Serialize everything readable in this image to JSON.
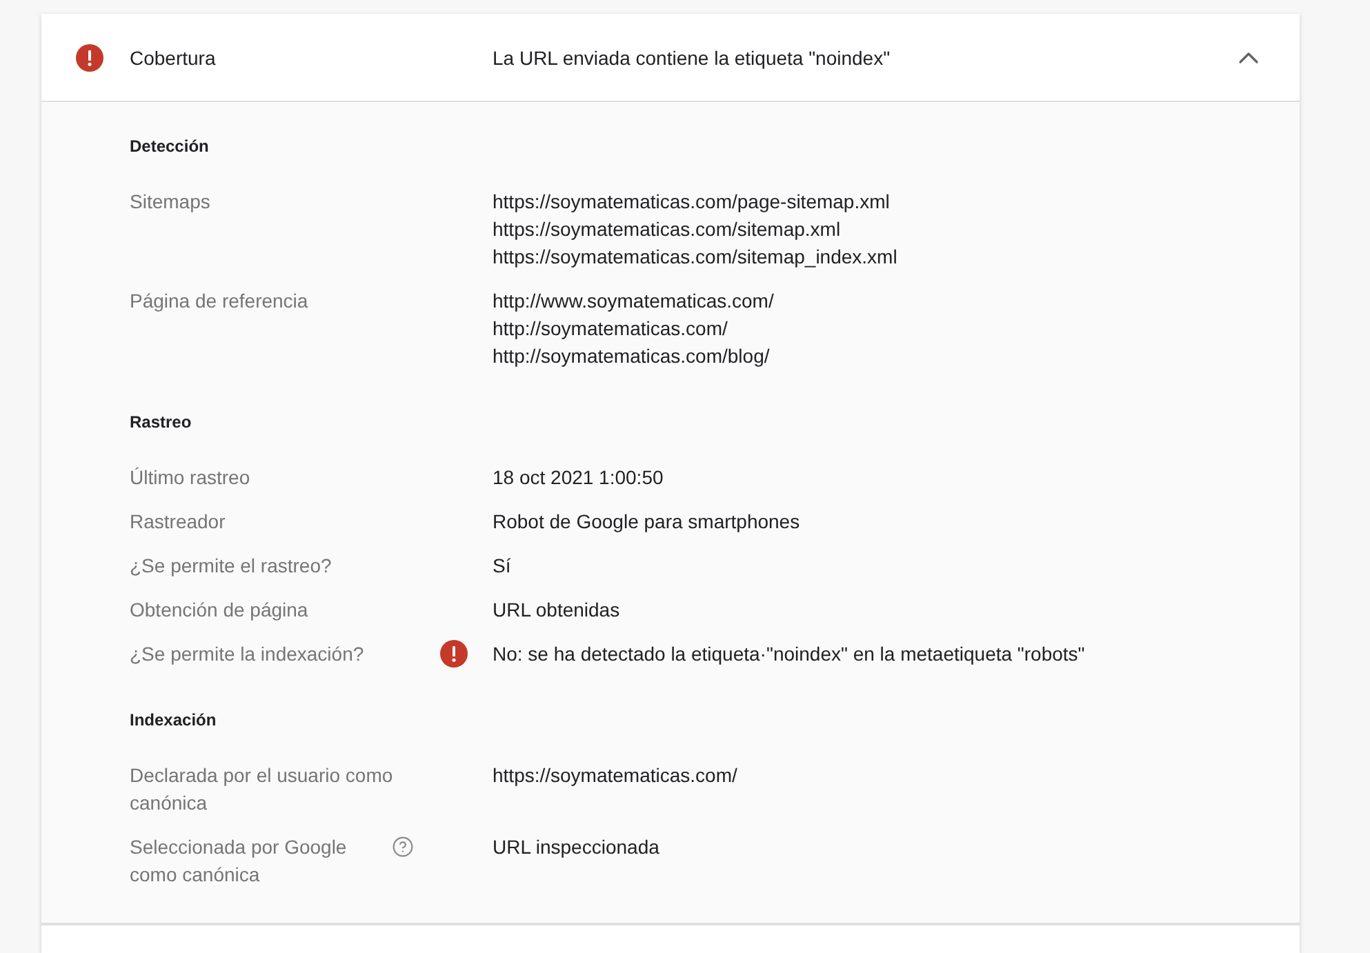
{
  "coverage": {
    "error": true,
    "label": "Cobertura",
    "value": "La URL enviada contiene la etiqueta \"noindex\"",
    "expanded": true
  },
  "sections": [
    {
      "title": "Detección",
      "rows": [
        {
          "label": "Sitemaps",
          "values": [
            "https://soymatematicas.com/page-sitemap.xml",
            "https://soymatematicas.com/sitemap.xml",
            "https://soymatematicas.com/sitemap_index.xml"
          ]
        },
        {
          "label": "Página de referencia",
          "values": [
            "http://www.soymatematicas.com/",
            "http://soymatematicas.com/",
            "http://soymatematicas.com/blog/"
          ]
        }
      ]
    },
    {
      "title": "Rastreo",
      "rows": [
        {
          "label": "Último rastreo",
          "values": [
            "18 oct 2021 1:00:50"
          ]
        },
        {
          "label": "Rastreador",
          "values": [
            "Robot de Google para smartphones"
          ]
        },
        {
          "label": "¿Se permite el rastreo?",
          "values": [
            "Sí"
          ]
        },
        {
          "label": "Obtención de página",
          "values": [
            "URL obtenidas"
          ]
        },
        {
          "label": "¿Se permite la indexación?",
          "error": true,
          "values": [
            "No: se ha detectado la etiqueta·\"noindex\" en la metaetiqueta \"robots\""
          ]
        }
      ]
    },
    {
      "title": "Indexación",
      "rows": [
        {
          "label": "Declarada por el usuario como canónica",
          "values": [
            "https://soymatematicas.com/"
          ]
        },
        {
          "label": "Seleccionada por Google como canónica",
          "help": true,
          "values": [
            "URL inspeccionada"
          ]
        }
      ]
    }
  ]
}
